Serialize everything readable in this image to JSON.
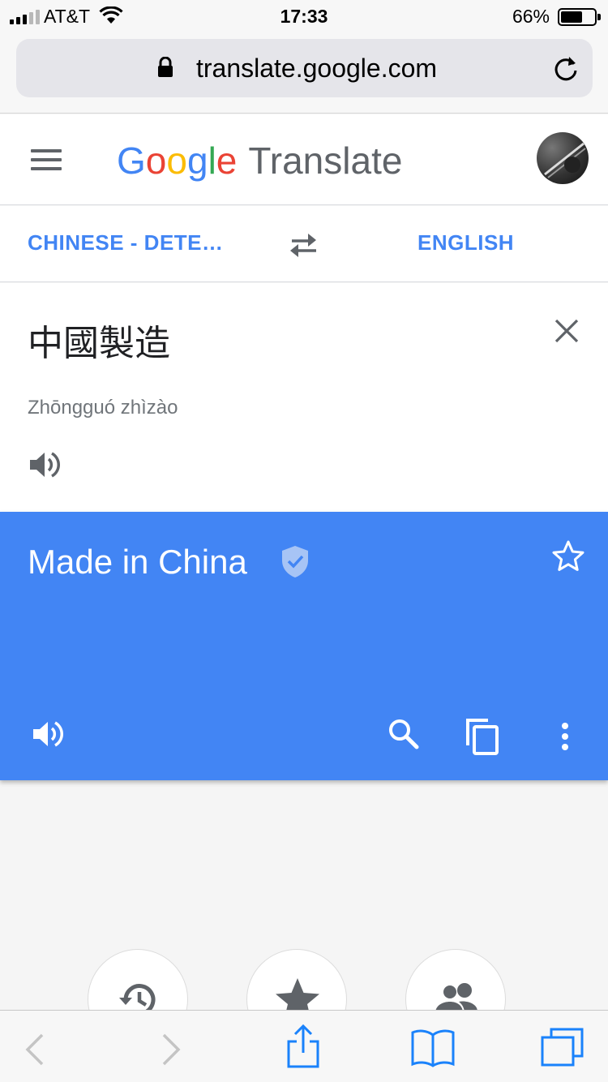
{
  "status_bar": {
    "carrier": "AT&T",
    "time": "17:33",
    "battery_percent": "66%",
    "battery_level": 0.66
  },
  "browser": {
    "url": "translate.google.com"
  },
  "header": {
    "logo_letters": [
      "G",
      "o",
      "o",
      "g",
      "l",
      "e"
    ],
    "product": "Translate"
  },
  "languages": {
    "source": "CHINESE - DETE…",
    "target": "ENGLISH"
  },
  "source": {
    "text": "中國製造",
    "romanization": "Zhōngguó zhìzào"
  },
  "result": {
    "text": "Made in China"
  },
  "colors": {
    "accent": "#4285f4",
    "google_red": "#ea4335",
    "google_yellow": "#fbbc05",
    "google_green": "#34a853"
  },
  "icons": {
    "history": "history-icon",
    "saved": "star-icon",
    "community": "people-icon"
  }
}
